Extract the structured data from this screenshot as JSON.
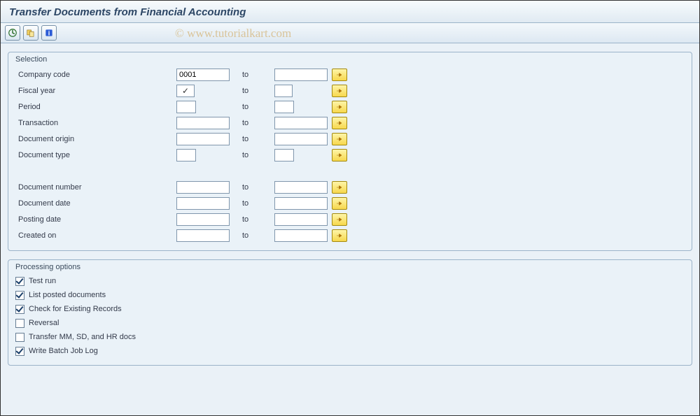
{
  "title": "Transfer Documents from Financial Accounting",
  "watermark": "© www.tutorialkart.com",
  "toolbar": {
    "execute": "execute",
    "variants": "variants",
    "info": "info"
  },
  "selection": {
    "title": "Selection",
    "to_label": "to",
    "rows": [
      {
        "label": "Company code",
        "size": "m",
        "from": "0001",
        "to": ""
      },
      {
        "label": "Fiscal year",
        "size": "check",
        "from": "✓",
        "to": ""
      },
      {
        "label": "Period",
        "size": "s",
        "from": "",
        "to": ""
      },
      {
        "label": "Transaction",
        "size": "m",
        "from": "",
        "to": ""
      },
      {
        "label": "Document origin",
        "size": "m",
        "from": "",
        "to": ""
      },
      {
        "label": "Document type",
        "size": "s",
        "from": "",
        "to": ""
      }
    ],
    "rows2": [
      {
        "label": "Document number",
        "size": "m",
        "from": "",
        "to": ""
      },
      {
        "label": "Document date",
        "size": "m",
        "from": "",
        "to": ""
      },
      {
        "label": "Posting date",
        "size": "m",
        "from": "",
        "to": ""
      },
      {
        "label": "Created on",
        "size": "m",
        "from": "",
        "to": ""
      }
    ]
  },
  "processing": {
    "title": "Processing options",
    "options": [
      {
        "label": "Test run",
        "checked": true
      },
      {
        "label": "List posted documents",
        "checked": true
      },
      {
        "label": "Check for Existing Records",
        "checked": true
      },
      {
        "label": "Reversal",
        "checked": false
      },
      {
        "label": "Transfer MM, SD, and HR docs",
        "checked": false
      },
      {
        "label": "Write Batch Job Log",
        "checked": true
      }
    ]
  }
}
